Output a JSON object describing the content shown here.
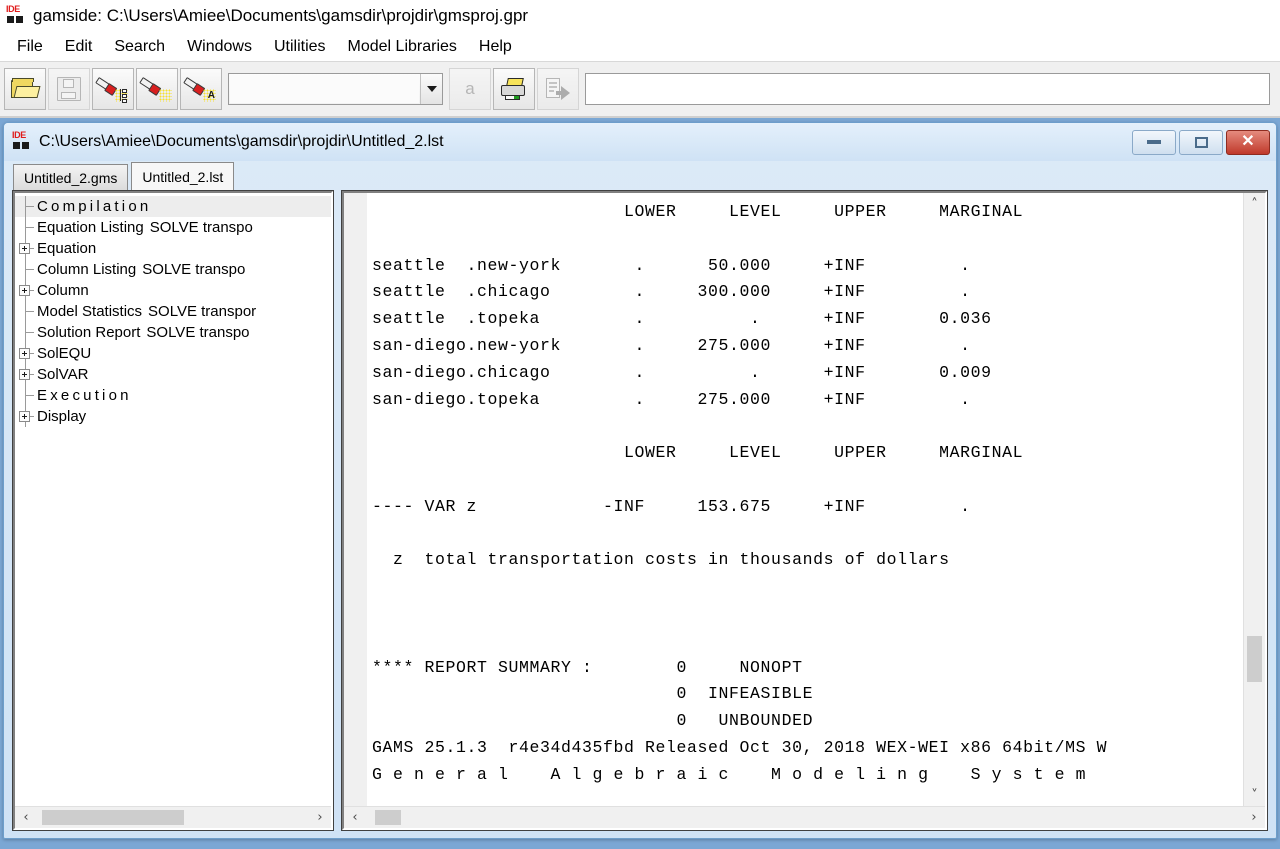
{
  "app": {
    "icon": "ide-icon",
    "title": "gamside: C:\\Users\\Amiee\\Documents\\gamsdir\\projdir\\gmsproj.gpr"
  },
  "menu": {
    "items": [
      {
        "label": "File"
      },
      {
        "label": "Edit"
      },
      {
        "label": "Search"
      },
      {
        "label": "Windows"
      },
      {
        "label": "Utilities"
      },
      {
        "label": "Model Libraries"
      },
      {
        "label": "Help"
      }
    ]
  },
  "toolbar": {
    "buttons": [
      {
        "name": "open-project",
        "icon": "folder-open-icon",
        "enabled": true
      },
      {
        "name": "save-file",
        "icon": "floppy-save-icon",
        "enabled": false
      },
      {
        "name": "run-gams",
        "icon": "flashlight-nodes-icon",
        "enabled": true
      },
      {
        "name": "run-current",
        "icon": "flashlight-icon",
        "enabled": true
      },
      {
        "name": "run-with-action",
        "icon": "flashlight-a-icon",
        "enabled": true
      }
    ],
    "combo": {
      "value": "",
      "arrow_icon": "chevron-down-icon"
    },
    "font_button": {
      "name": "font-button",
      "label": "a",
      "icon": "a-glyph-icon",
      "enabled": false
    },
    "print_button": {
      "name": "print-button",
      "icon": "printer-icon",
      "enabled": true
    },
    "export_button": {
      "name": "export-button",
      "icon": "document-arrow-icon",
      "enabled": false
    },
    "textbox": {
      "value": "",
      "placeholder": ""
    }
  },
  "child_window": {
    "icon": "ide-icon",
    "title": "C:\\Users\\Amiee\\Documents\\gamsdir\\projdir\\Untitled_2.lst",
    "controls": {
      "minimize": {
        "name": "minimize-button",
        "icon": "minimize-icon"
      },
      "restore": {
        "name": "restore-button",
        "icon": "restore-icon"
      },
      "close": {
        "name": "close-button",
        "icon": "close-icon",
        "color": "#c0392b"
      }
    },
    "tabs": [
      {
        "label": "Untitled_2.gms",
        "active": false
      },
      {
        "label": "Untitled_2.lst",
        "active": true
      }
    ]
  },
  "tree": {
    "items": [
      {
        "label": "Compilation",
        "aux": "",
        "expandable": false,
        "spaced": true,
        "selected": true
      },
      {
        "label": "Equation Listing",
        "aux": "SOLVE transpo",
        "expandable": false,
        "spaced": false,
        "selected": false
      },
      {
        "label": "Equation",
        "aux": "",
        "expandable": true,
        "spaced": false,
        "selected": false
      },
      {
        "label": "Column Listing",
        "aux": "SOLVE transpo",
        "expandable": false,
        "spaced": false,
        "selected": false
      },
      {
        "label": "Column",
        "aux": "",
        "expandable": true,
        "spaced": false,
        "selected": false
      },
      {
        "label": "Model Statistics",
        "aux": "SOLVE transpor",
        "expandable": false,
        "spaced": false,
        "selected": false
      },
      {
        "label": "Solution Report",
        "aux": "SOLVE transpo",
        "expandable": false,
        "spaced": false,
        "selected": false
      },
      {
        "label": "SolEQU",
        "aux": "",
        "expandable": true,
        "spaced": false,
        "selected": false
      },
      {
        "label": "SolVAR",
        "aux": "",
        "expandable": true,
        "spaced": false,
        "selected": false
      },
      {
        "label": "Execution",
        "aux": "",
        "expandable": false,
        "spaced": true,
        "selected": false
      },
      {
        "label": "Display",
        "aux": "",
        "expandable": true,
        "spaced": false,
        "selected": false
      }
    ]
  },
  "listing": {
    "text": "                        LOWER     LEVEL     UPPER     MARGINAL\n\nseattle  .new-york       .      50.000     +INF         .\nseattle  .chicago        .     300.000     +INF         .\nseattle  .topeka         .          .      +INF       0.036\nsan-diego.new-york       .     275.000     +INF         .\nsan-diego.chicago        .          .      +INF       0.009\nsan-diego.topeka         .     275.000     +INF         .\n\n                        LOWER     LEVEL     UPPER     MARGINAL\n\n---- VAR z            -INF     153.675     +INF         .\n\n  z  total transportation costs in thousands of dollars\n\n\n\n**** REPORT SUMMARY :        0     NONOPT\n                             0  INFEASIBLE\n                             0   UNBOUNDED\nGAMS 25.1.3  r4e34d435fbd Released Oct 30, 2018 WEX-WEI x86 64bit/MS W\nG e n e r a l    A l g e b r a i c    M o d e l i n g    S y s t e m",
    "columns": [
      "LOWER",
      "LEVEL",
      "UPPER",
      "MARGINAL"
    ],
    "rows": [
      {
        "name": "seattle  .new-york",
        "lower": ".",
        "level": "50.000",
        "upper": "+INF",
        "marginal": "."
      },
      {
        "name": "seattle  .chicago",
        "lower": ".",
        "level": "300.000",
        "upper": "+INF",
        "marginal": "."
      },
      {
        "name": "seattle  .topeka",
        "lower": ".",
        "level": ".",
        "upper": "+INF",
        "marginal": "0.036"
      },
      {
        "name": "san-diego.new-york",
        "lower": ".",
        "level": "275.000",
        "upper": "+INF",
        "marginal": "."
      },
      {
        "name": "san-diego.chicago",
        "lower": ".",
        "level": ".",
        "upper": "+INF",
        "marginal": "0.009"
      },
      {
        "name": "san-diego.topeka",
        "lower": ".",
        "level": "275.000",
        "upper": "+INF",
        "marginal": "."
      }
    ],
    "objective": {
      "label": "---- VAR z",
      "lower": "-INF",
      "level": "153.675",
      "upper": "+INF",
      "marginal": "."
    },
    "objective_desc": "z  total transportation costs in thousands of dollars",
    "report_summary": {
      "heading": "**** REPORT SUMMARY :",
      "entries": [
        {
          "count": "0",
          "status": "NONOPT"
        },
        {
          "count": "0",
          "status": "INFEASIBLE"
        },
        {
          "count": "0",
          "status": "UNBOUNDED"
        }
      ]
    },
    "footer_version": "GAMS 25.1.3  r4e34d435fbd Released Oct 30, 2018 WEX-WEI x86 64bit/MS W",
    "footer_name": "G e n e r a l    A l g e b r a i c    M o d e l i n g    S y s t e m"
  },
  "scrollbars": {
    "tree_h": {
      "thumb_left_pct": 2,
      "thumb_width_pct": 52,
      "left_icon": "chevron-left-icon",
      "right_icon": "chevron-right-icon"
    },
    "text_h": {
      "thumb_left_pct": 1,
      "thumb_width_pct": 3,
      "left_icon": "chevron-left-icon",
      "right_icon": "chevron-right-icon"
    },
    "text_v": {
      "thumb_top_pct": 74,
      "thumb_height_pct": 8,
      "up_icon": "chevron-up-icon",
      "down_icon": "chevron-down-icon"
    }
  },
  "glyphs": {
    "chevron_left": "‹",
    "chevron_right": "›",
    "chevron_up": "˄",
    "chevron_down": "˅",
    "ide_label": "IDE"
  }
}
